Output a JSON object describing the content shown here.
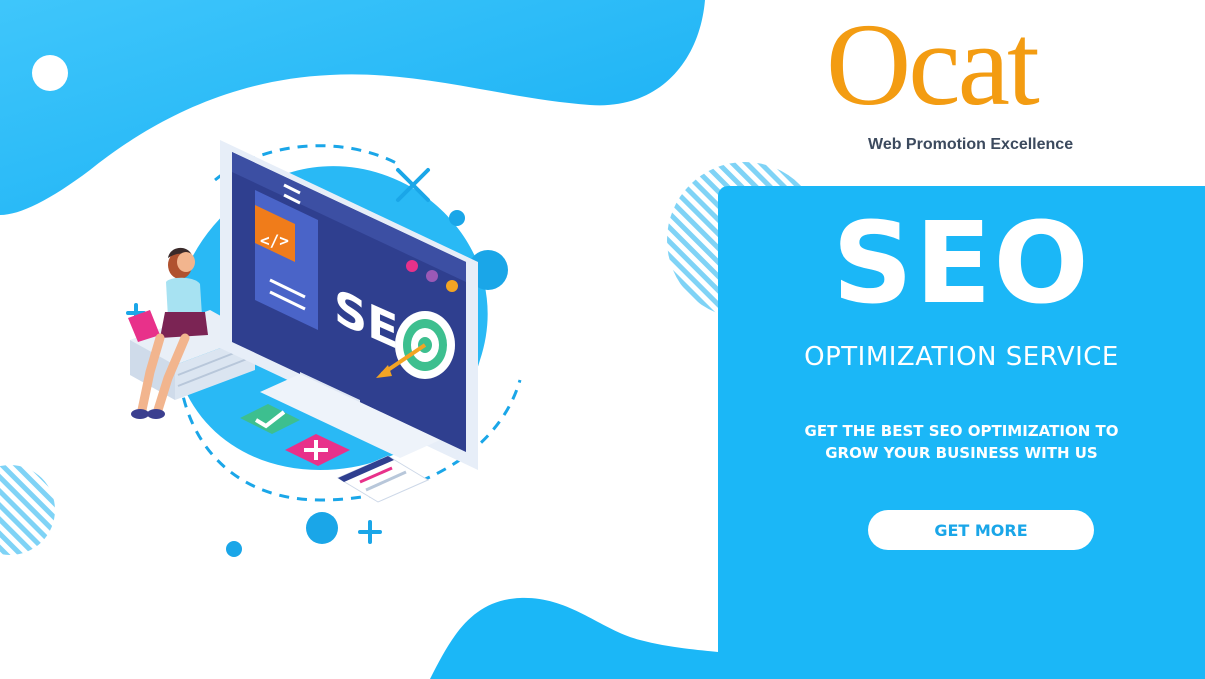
{
  "logo": {
    "word": "Ocat",
    "tagline": "Web Promotion Excellence"
  },
  "illustration": {
    "screen_text": "SE",
    "code_tag": "</>",
    "icons": [
      "code-icon",
      "target-icon",
      "arrow-icon",
      "check-icon",
      "plus-icon",
      "woman-with-laptop"
    ]
  },
  "hero": {
    "title": "SEO",
    "subtitle": "OPTIMIZATION SERVICE",
    "tagline_line1": "GET THE BEST SEO OPTIMIZATION TO",
    "tagline_line2": "GROW YOUR BUSINESS WITH US",
    "cta_label": "GET MORE"
  },
  "colors": {
    "brand_orange": "#f39c12",
    "panel_blue": "#1bb7f7",
    "monitor_navy": "#2c3e8c",
    "accent_pink": "#e8318a",
    "accent_green": "#3dbf8f"
  }
}
